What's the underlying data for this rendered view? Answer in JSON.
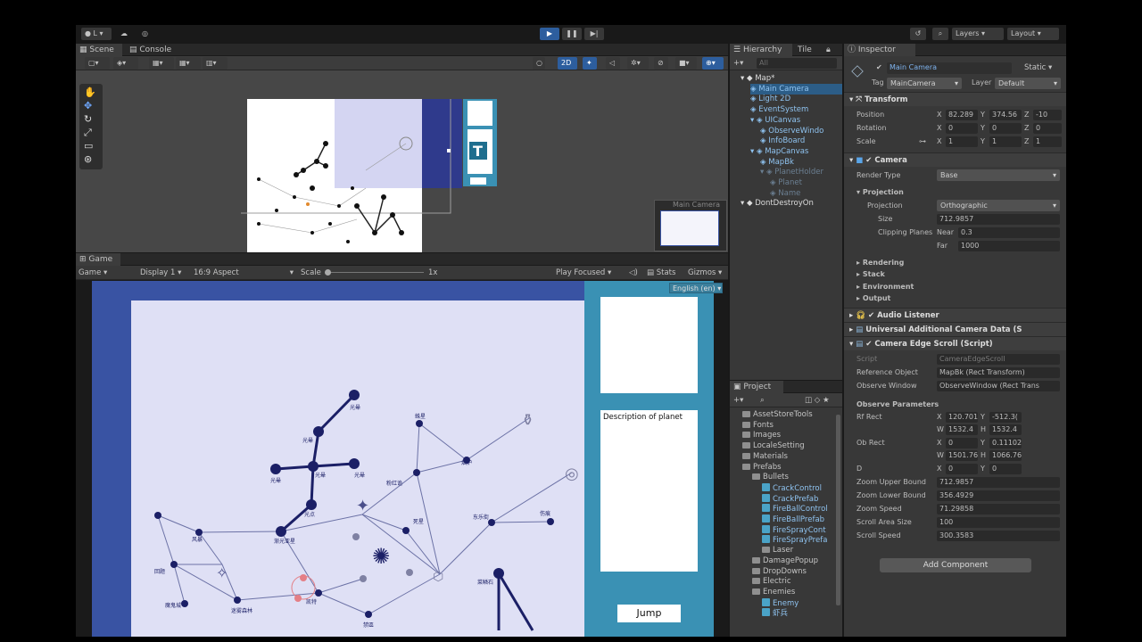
{
  "toolbar": {
    "account": "L",
    "layers": "Layers",
    "layout": "Layout"
  },
  "scene_panel": {
    "tabs": [
      "Scene",
      "Console"
    ],
    "mode_2d": "2D",
    "camera_preview_label": "Main Camera"
  },
  "game_panel": {
    "tab": "Game",
    "display_mode": "Game",
    "display": "Display 1",
    "aspect": "16:9 Aspect",
    "scale_label": "Scale",
    "scale_value": "1x",
    "play_mode": "Play Focused",
    "stats": "Stats",
    "gizmos": "Gizmos",
    "language": "English (en)",
    "description_text": "Description of planet",
    "jump_label": "Jump"
  },
  "map_nodes": [
    "光晕",
    "光晕",
    "光晕",
    "光晕",
    "光晕",
    "光晕",
    "光点",
    "渐光亚星",
    "风暴",
    "回题",
    "迷雾森林",
    "魔鬼城",
    "凯特",
    "禁區",
    "粉红诡",
    "蛛星",
    "烟炉",
    "东乐街",
    "伤痕",
    "菜鳞石",
    "死星"
  ],
  "hierarchy": {
    "tabs": [
      "Hierarchy",
      "Tile"
    ],
    "search_placeholder": "All",
    "items": [
      {
        "label": "Map*",
        "depth": 0
      },
      {
        "label": "Main Camera",
        "depth": 1
      },
      {
        "label": "Light 2D",
        "depth": 1
      },
      {
        "label": "EventSystem",
        "depth": 1
      },
      {
        "label": "UICanvas",
        "depth": 1
      },
      {
        "label": "ObserveWindo",
        "depth": 2
      },
      {
        "label": "InfoBoard",
        "depth": 2
      },
      {
        "label": "MapCanvas",
        "depth": 1
      },
      {
        "label": "MapBk",
        "depth": 2
      },
      {
        "label": "PlanetHolder",
        "depth": 2
      },
      {
        "label": "Planet",
        "depth": 3
      },
      {
        "label": "Name",
        "depth": 3
      },
      {
        "label": "DontDestroyOn",
        "depth": 0
      }
    ]
  },
  "project": {
    "tab": "Project",
    "items": [
      {
        "label": "AssetStoreTools",
        "type": "folder",
        "depth": 0
      },
      {
        "label": "Fonts",
        "type": "folder",
        "depth": 0
      },
      {
        "label": "Images",
        "type": "folder",
        "depth": 0
      },
      {
        "label": "LocaleSetting",
        "type": "folder",
        "depth": 0
      },
      {
        "label": "Materials",
        "type": "folder",
        "depth": 0
      },
      {
        "label": "Prefabs",
        "type": "folder",
        "depth": 0
      },
      {
        "label": "Bullets",
        "type": "folder",
        "depth": 1
      },
      {
        "label": "CrackControl",
        "type": "prefab",
        "depth": 2
      },
      {
        "label": "CrackPrefab",
        "type": "prefab",
        "depth": 2
      },
      {
        "label": "FireBallControl",
        "type": "prefab",
        "depth": 2
      },
      {
        "label": "FireBallPrefab",
        "type": "prefab",
        "depth": 2
      },
      {
        "label": "FireSprayCont",
        "type": "prefab",
        "depth": 2
      },
      {
        "label": "FireSprayPrefa",
        "type": "prefab",
        "depth": 2
      },
      {
        "label": "Laser",
        "type": "folder",
        "depth": 2
      },
      {
        "label": "DamagePopup",
        "type": "folder",
        "depth": 1
      },
      {
        "label": "DropDowns",
        "type": "folder",
        "depth": 1
      },
      {
        "label": "Electric",
        "type": "folder",
        "depth": 1
      },
      {
        "label": "Enemies",
        "type": "folder",
        "depth": 1
      },
      {
        "label": "Enemy",
        "type": "prefab",
        "depth": 2
      },
      {
        "label": "虾兵",
        "type": "prefab",
        "depth": 2
      }
    ]
  },
  "inspector": {
    "tab": "Inspector",
    "object_name": "Main Camera",
    "static": "Static",
    "tag_label": "Tag",
    "tag": "MainCamera",
    "layer_label": "Layer",
    "layer": "Default",
    "transform": {
      "title": "Transform",
      "position_label": "Position",
      "position": [
        "82.289",
        "374.56",
        "-10"
      ],
      "rotation_label": "Rotation",
      "rotation": [
        "0",
        "0",
        "0"
      ],
      "scale_label": "Scale",
      "scale": [
        "1",
        "1",
        "1"
      ]
    },
    "camera": {
      "title": "Camera",
      "render_type_label": "Render Type",
      "render_type": "Base",
      "projection_section": "Projection",
      "projection_label": "Projection",
      "projection": "Orthographic",
      "size_label": "Size",
      "size": "712.9857",
      "clip_label": "Clipping Planes",
      "near_label": "Near",
      "near": "0.3",
      "far_label": "Far",
      "far": "1000",
      "subsections": [
        "Rendering",
        "Stack",
        "Environment",
        "Output"
      ]
    },
    "audio_listener": "Audio Listener",
    "urp_data": "Universal Additional Camera Data (S",
    "edge_scroll": {
      "title": "Camera Edge Scroll (Script)",
      "script_label": "Script",
      "script": "CameraEdgeScroll",
      "ref_label": "Reference Object",
      "ref": "MapBk (Rect Transform)",
      "observe_label": "Observe Window",
      "observe": "ObserveWindow (Rect Trans",
      "params_title": "Observe Parameters",
      "rf_label": "Rf Rect",
      "rf": [
        "120.701",
        "-512.3(",
        "1532.4",
        "1532.4"
      ],
      "ob_label": "Ob Rect",
      "ob": [
        "0",
        "0.11102",
        "1501.76",
        "1066.76"
      ],
      "d_label": "D",
      "d": [
        "0",
        "0"
      ],
      "zoom_upper_label": "Zoom Upper Bound",
      "zoom_upper": "712.9857",
      "zoom_lower_label": "Zoom Lower Bound",
      "zoom_lower": "356.4929",
      "zoom_speed_label": "Zoom Speed",
      "zoom_speed": "71.29858",
      "scroll_area_label": "Scroll Area Size",
      "scroll_area": "100",
      "scroll_speed_label": "Scroll Speed",
      "scroll_speed": "300.3583"
    },
    "add_component": "Add Component"
  },
  "colors": {
    "accent": "#2d5e9e",
    "panel": "#383838",
    "game_side": "#3a91b4",
    "map_bg": "#dfe0f5",
    "node": "#1b1f66"
  }
}
